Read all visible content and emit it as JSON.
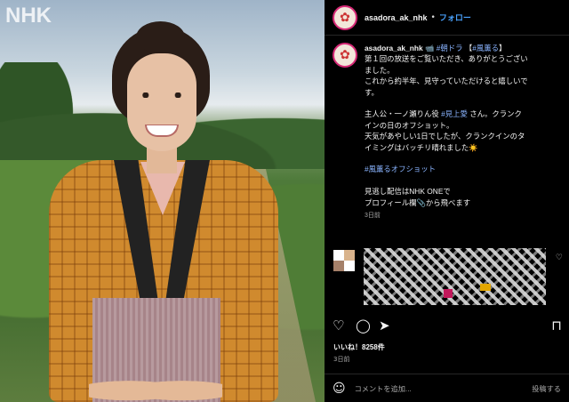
{
  "photo": {
    "watermark": "NHK"
  },
  "header": {
    "username": "asadora_ak_nhk",
    "separator": "•",
    "follow_label": "フォロー"
  },
  "caption": {
    "username": "asadora_ak_nhk",
    "username_emoji": "📹",
    "tag1": "#朝ドラ",
    "tag2_prefix": "【",
    "tag2": "#風薫る",
    "tag2_suffix": "】",
    "line1": "第１回の放送をご覧いただき、ありがとうござい",
    "line2": "ました。",
    "line3": "これから約半年、見守っていただけると嬉しいで",
    "line4": "す。",
    "line5_pre": "主人公・一ノ瀬りん役 ",
    "line5_tag": "#見上愛",
    "line5_post": " さん。クランク",
    "line6": "インの日のオフショット。",
    "line7": "天気があやしい1日でしたが、クランクインのタ",
    "line8": "イミングはバッチリ晴れました☀️",
    "hashtag_line": "#風薫るオフショット",
    "line9": "見逃し配信はNHK ONEで",
    "line10": "プロフィール欄📎から飛べます",
    "time_ago": "3日前"
  },
  "comment": {
    "like_icon": "heart-icon"
  },
  "actions": {
    "like_icon": "heart-icon",
    "comment_icon": "comment-icon",
    "share_icon": "send-icon",
    "save_icon": "bookmark-icon"
  },
  "stats": {
    "likes_text": "いいね！8258件",
    "date_text": "3日前"
  },
  "comment_bar": {
    "emoji_icon": "smiley-icon",
    "placeholder": "コメントを追加...",
    "post_label": "投稿する"
  },
  "colors": {
    "link_blue": "#4aa3ff",
    "hashtag_blue": "#8ab4ff",
    "background": "#000000"
  }
}
